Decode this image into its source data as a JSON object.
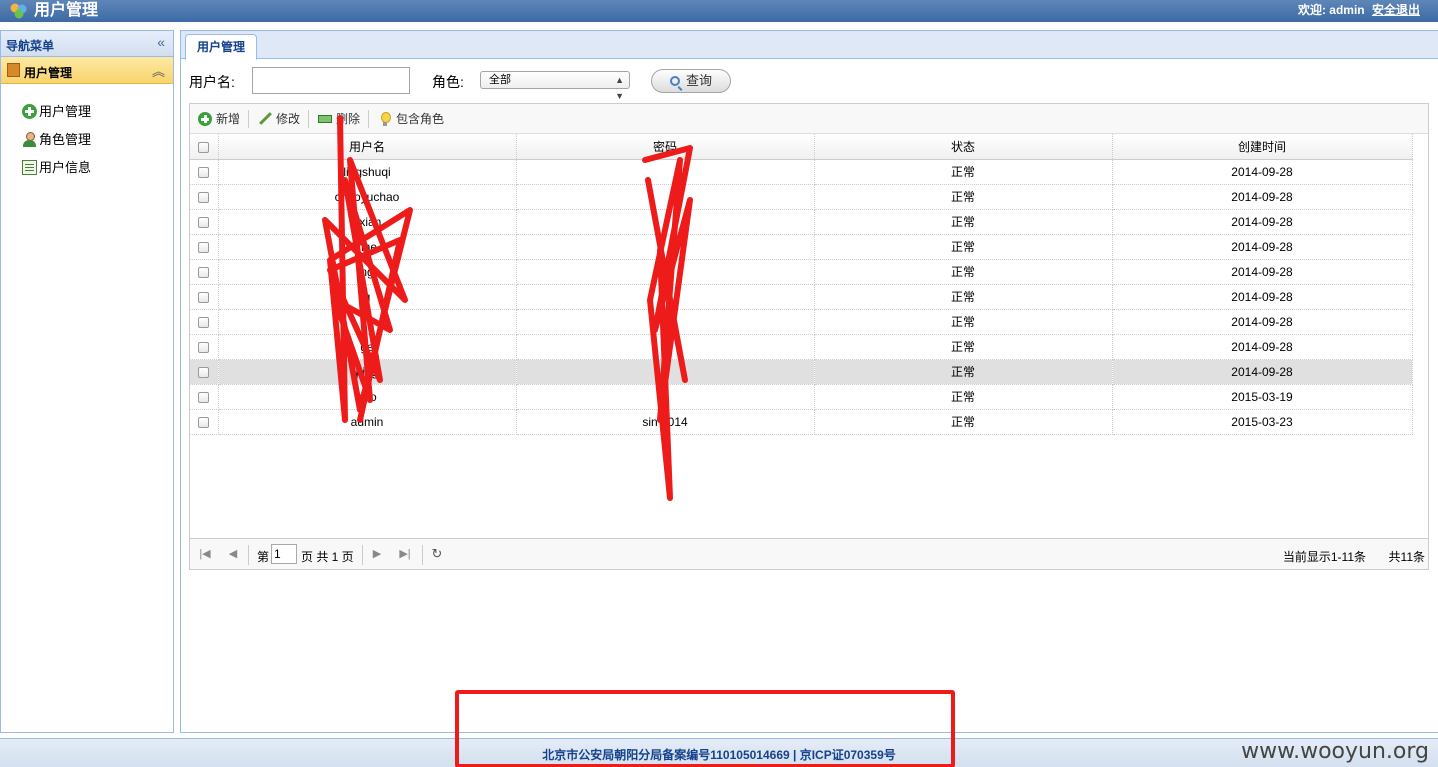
{
  "app": {
    "title": "用户管理",
    "welcome": "欢迎: admin",
    "logout": "安全退出"
  },
  "nav": {
    "header": "导航菜单",
    "section": "用户管理",
    "items": [
      {
        "label": "用户管理",
        "icon": "add-user-icon"
      },
      {
        "label": "角色管理",
        "icon": "user-icon"
      },
      {
        "label": "用户信息",
        "icon": "info-icon"
      }
    ]
  },
  "tab": {
    "label": "用户管理"
  },
  "search": {
    "username_label": "用户名:",
    "username_value": "",
    "role_label": "角色:",
    "role_selected": "全部",
    "query_button": "查询"
  },
  "toolbar": {
    "add": "新增",
    "edit": "修改",
    "delete": "删除",
    "include_role": "包含角色"
  },
  "table": {
    "columns": [
      "用户名",
      "密码",
      "状态",
      "创建时间"
    ],
    "rows": [
      [
        "lingshuqi",
        "",
        "正常",
        "2014-09-28"
      ],
      [
        "chaoyuchao",
        "",
        "正常",
        "2014-09-28"
      ],
      [
        "gxian",
        "",
        "正常",
        "2014-09-28"
      ],
      [
        "nhe",
        "",
        "正常",
        "2014-09-28"
      ],
      [
        "ng",
        "3",
        "正常",
        "2014-09-28"
      ],
      [
        "g",
        "",
        "正常",
        "2014-09-28"
      ],
      [
        "uo",
        "",
        "正常",
        "2014-09-28"
      ],
      [
        "ge",
        "",
        "正常",
        "2014-09-28"
      ],
      [
        "ping",
        "",
        "正常",
        "2014-09-28"
      ],
      [
        "cao",
        "3",
        "正常",
        "2015-03-19"
      ],
      [
        "admin",
        "sin 2014",
        "正常",
        "2015-03-23"
      ]
    ],
    "selected_row": 8
  },
  "pager": {
    "page_prefix": "第",
    "page_value": "1",
    "page_suffix": "页 共 1 页",
    "showing": "当前显示1-11条",
    "total": "共11条"
  },
  "footer": {
    "legal": "北京市公安局朝阳分局备案编号110105014669 | 京ICP证070359号",
    "watermark": "www.wooyun.org"
  },
  "colors": {
    "header_blue": "#3c6aa5",
    "accent_border": "#99bbe8",
    "highlight": "#f8d46e",
    "redaction": "#ee1b1b"
  }
}
